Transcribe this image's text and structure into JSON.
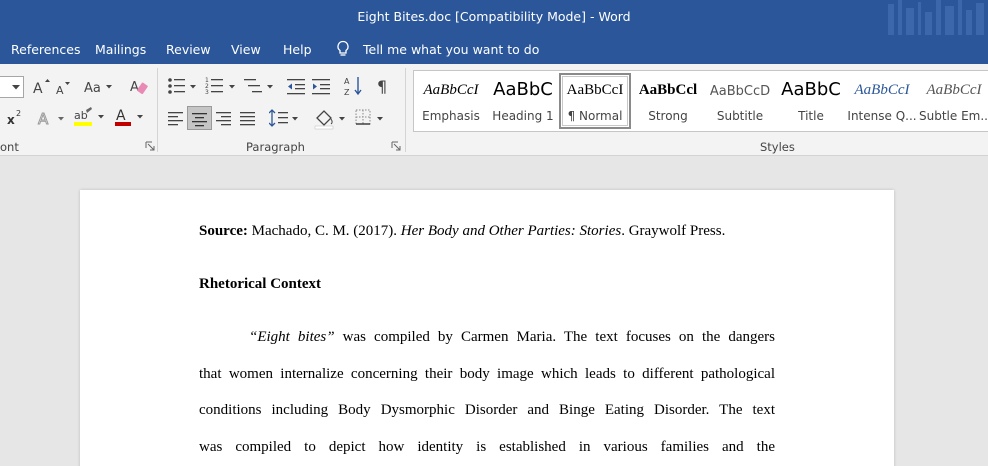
{
  "window": {
    "title": "Eight Bites.doc [Compatibility Mode]  -  Word"
  },
  "tabs": [
    {
      "label": "References"
    },
    {
      "label": "Mailings"
    },
    {
      "label": "Review"
    },
    {
      "label": "View"
    },
    {
      "label": "Help"
    }
  ],
  "tell_me": {
    "placeholder": "Tell me what you want to do"
  },
  "groups": {
    "font": "ont",
    "paragraph": "Paragraph",
    "styles": "Styles"
  },
  "styles": [
    {
      "sample": "AaBbCcI",
      "name": "Emphasis"
    },
    {
      "sample": "AaBbC",
      "name": "Heading 1"
    },
    {
      "sample": "AaBbCcI",
      "name": "¶ Normal",
      "selected": true
    },
    {
      "sample": "AaBbCcl",
      "name": "Strong"
    },
    {
      "sample": "AaBbCcD",
      "name": "Subtitle"
    },
    {
      "sample": "AaBbC",
      "name": "Title"
    },
    {
      "sample": "AaBbCcI",
      "name": "Intense Q..."
    },
    {
      "sample": "AaBbCcI",
      "name": "Subtle Em..."
    }
  ],
  "document": {
    "source_label": "Source:",
    "source_author": " Machado, C. M. (2017). ",
    "source_book": "Her Body and Other Parties: Stories",
    "source_publisher": ". Graywolf Press.",
    "heading": "Rhetorical Context",
    "p1_quote": "“Eight bites”",
    "p1_rest": " was compiled by Carmen Maria. The text focuses on the dangers",
    "p2": "that women internalize concerning their body image which leads to different pathological",
    "p3": "conditions including Body Dysmorphic Disorder and Binge Eating Disorder. The text",
    "p4": "was compiled to depict how identity is established in various families and the"
  },
  "colors": {
    "brand": "#2b579a",
    "highlight": "#ffff00",
    "font_color": "#c00000"
  }
}
